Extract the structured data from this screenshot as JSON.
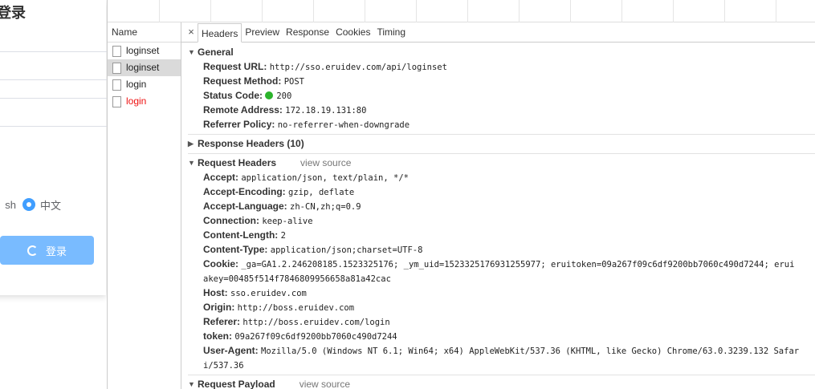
{
  "app": {
    "title": "系统登录",
    "lang_en": "sh",
    "lang_zh": "中文",
    "login_button": "登录"
  },
  "network": {
    "name_header": "Name",
    "requests": [
      {
        "name": "loginset",
        "status": "normal"
      },
      {
        "name": "loginset",
        "status": "selected"
      },
      {
        "name": "login",
        "status": "normal"
      },
      {
        "name": "login",
        "status": "error"
      }
    ]
  },
  "tabs": {
    "close": "×",
    "items": [
      "Headers",
      "Preview",
      "Response",
      "Cookies",
      "Timing"
    ],
    "active": "Headers"
  },
  "general": {
    "title": "General",
    "rows": [
      {
        "k": "Request URL:",
        "v": "http://sso.eruidev.com/api/loginset"
      },
      {
        "k": "Request Method:",
        "v": "POST"
      },
      {
        "k": "Status Code:",
        "v": "200"
      },
      {
        "k": "Remote Address:",
        "v": "172.18.19.131:80"
      },
      {
        "k": "Referrer Policy:",
        "v": "no-referrer-when-downgrade"
      }
    ]
  },
  "response_headers": {
    "title": "Response Headers (10)"
  },
  "request_headers": {
    "title": "Request Headers",
    "view_source": "view source",
    "rows": [
      {
        "k": "Accept:",
        "v": "application/json, text/plain, */*"
      },
      {
        "k": "Accept-Encoding:",
        "v": "gzip, deflate"
      },
      {
        "k": "Accept-Language:",
        "v": "zh-CN,zh;q=0.9"
      },
      {
        "k": "Connection:",
        "v": "keep-alive"
      },
      {
        "k": "Content-Length:",
        "v": "2"
      },
      {
        "k": "Content-Type:",
        "v": "application/json;charset=UTF-8"
      },
      {
        "k": "Cookie:",
        "v": "_ga=GA1.2.246208185.1523325176; _ym_uid=1523325176931255977; eruitoken=09a267f09c6df9200bb7060c490d7244; erui"
      },
      {
        "k": "",
        "v": "akey=00485f514f7846809956658a81a42cac"
      },
      {
        "k": "Host:",
        "v": "sso.eruidev.com"
      },
      {
        "k": "Origin:",
        "v": "http://boss.eruidev.com"
      },
      {
        "k": "Referer:",
        "v": "http://boss.eruidev.com/login"
      },
      {
        "k": "token:",
        "v": "09a267f09c6df9200bb7060c490d7244"
      },
      {
        "k": "User-Agent:",
        "v": "Mozilla/5.0 (Windows NT 6.1; Win64; x64) AppleWebKit/537.36 (KHTML, like Gecko) Chrome/63.0.3239.132 Safar"
      },
      {
        "k": "",
        "v": "i/537.36"
      }
    ]
  },
  "request_payload": {
    "title": "Request Payload",
    "view_source": "view source",
    "body": "{}"
  },
  "colors": {
    "accent": "#409eff",
    "error": "#ee1111",
    "status_ok": "#2bb32b"
  }
}
